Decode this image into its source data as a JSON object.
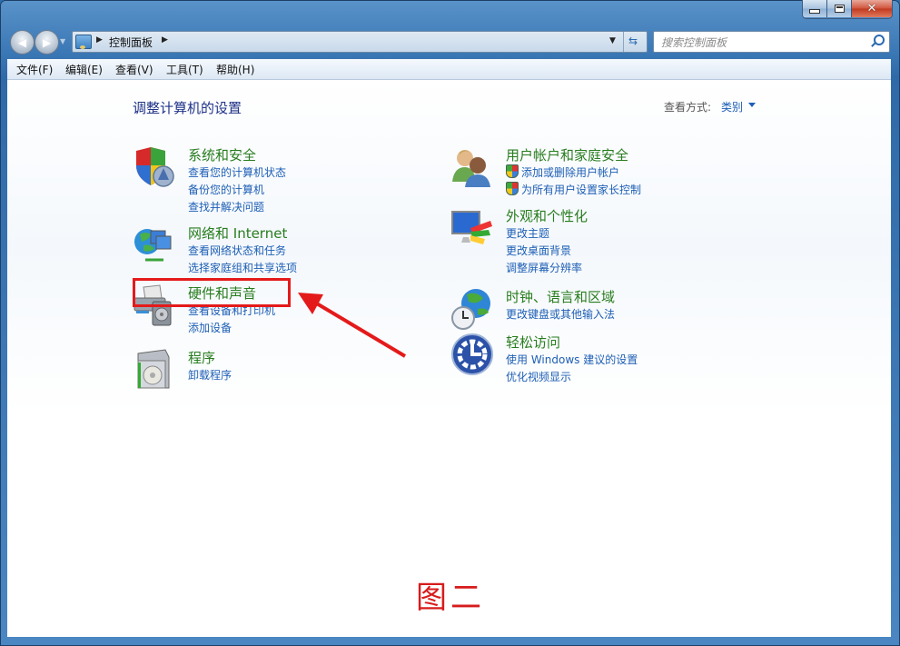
{
  "window": {
    "caption_buttons": {
      "minimize": "minimize",
      "maximize": "maximize",
      "close": "close"
    }
  },
  "navigation": {
    "back_icon": "back-arrow-icon",
    "forward_icon": "forward-arrow-icon",
    "address": {
      "icon": "control-panel-icon",
      "breadcrumb": [
        "控制面板"
      ]
    },
    "search": {
      "placeholder": "搜索控制面板",
      "value": ""
    }
  },
  "menubar": {
    "items": [
      {
        "label": "文件(F)"
      },
      {
        "label": "编辑(E)"
      },
      {
        "label": "查看(V)"
      },
      {
        "label": "工具(T)"
      },
      {
        "label": "帮助(H)"
      }
    ]
  },
  "main": {
    "title": "调整计算机的设置",
    "view_by": {
      "label": "查看方式:",
      "value": "类别"
    },
    "categories": [
      {
        "title": "系统和安全",
        "icon": "security-shield-icon",
        "links": [
          "查看您的计算机状态",
          "备份您的计算机",
          "查找并解决问题"
        ]
      },
      {
        "title": "网络和 Internet",
        "icon": "network-globe-icon",
        "links": [
          "查看网络状态和任务",
          "选择家庭组和共享选项"
        ]
      },
      {
        "title": "硬件和声音",
        "icon": "printer-speaker-icon",
        "links": [
          "查看设备和打印机",
          "添加设备"
        ]
      },
      {
        "title": "程序",
        "icon": "programs-box-icon",
        "links": [
          "卸载程序"
        ]
      },
      {
        "title": "用户帐户和家庭安全",
        "icon": "users-icon",
        "links": [
          "添加或删除用户帐户",
          "为所有用户设置家长控制"
        ]
      },
      {
        "title": "外观和个性化",
        "icon": "monitor-palette-icon",
        "links": [
          "更改主题",
          "更改桌面背景",
          "调整屏幕分辨率"
        ]
      },
      {
        "title": "时钟、语言和区域",
        "icon": "globe-clock-icon",
        "links": [
          "更改键盘或其他输入法"
        ]
      },
      {
        "title": "轻松访问",
        "icon": "ease-of-access-icon",
        "links": [
          "使用 Windows 建议的设置",
          "优化视频显示"
        ]
      }
    ]
  },
  "annotation": {
    "caption": "图二",
    "highlight_color": "#e41a1a"
  }
}
